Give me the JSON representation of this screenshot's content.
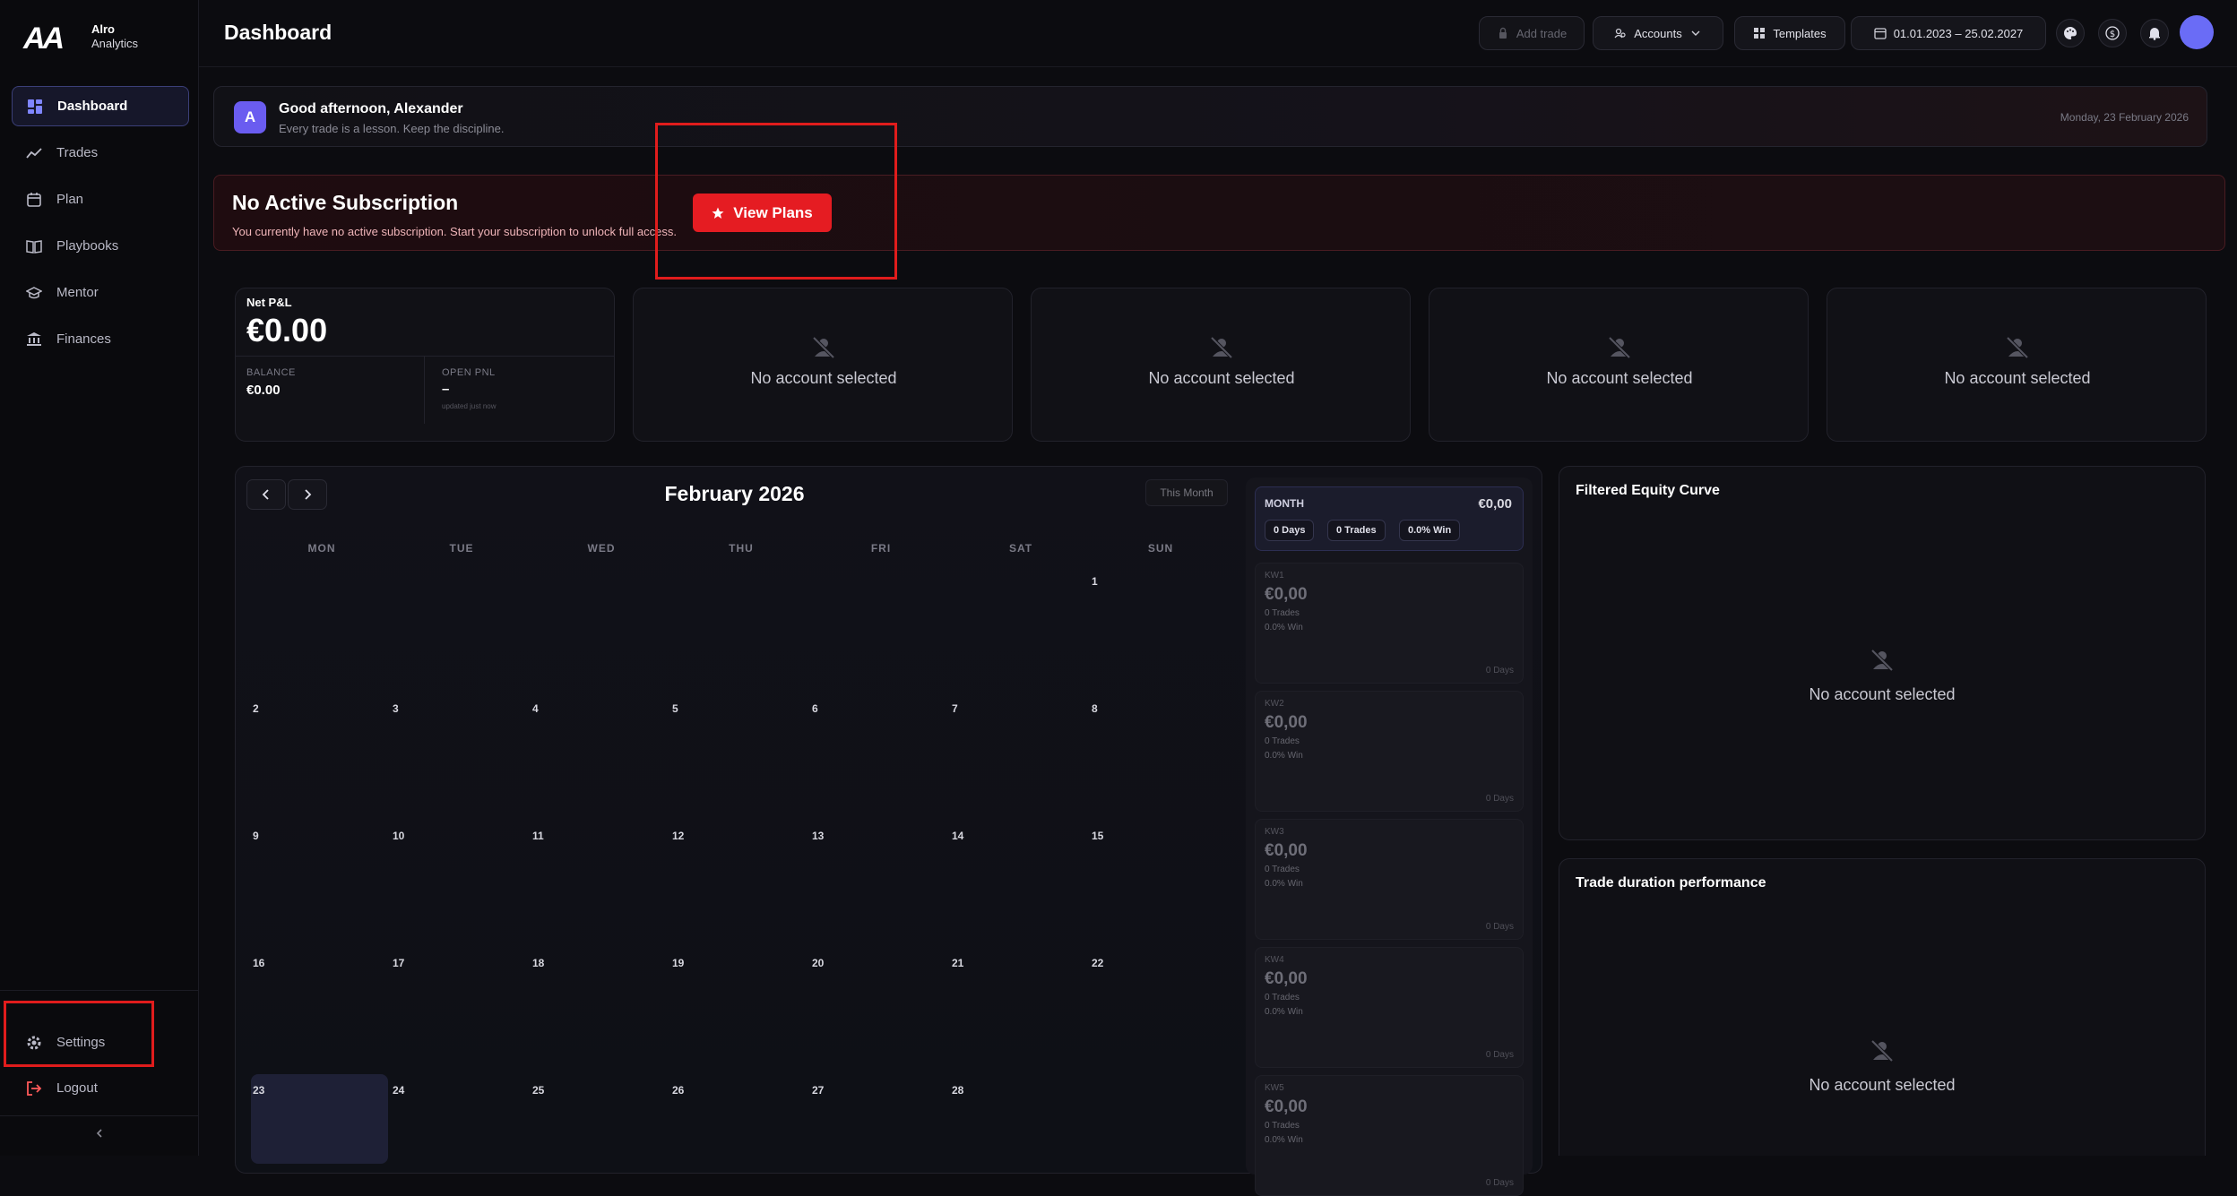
{
  "app": {
    "logo_mark": "AA",
    "logo_name": "Alro",
    "logo_subtitle": "Analytics"
  },
  "sidebar": {
    "items": [
      {
        "label": "Dashboard",
        "icon": "grid-icon",
        "active": true
      },
      {
        "label": "Trades",
        "icon": "trend-line-icon"
      },
      {
        "label": "Plan",
        "icon": "calendar-icon"
      },
      {
        "label": "Playbooks",
        "icon": "book-icon"
      },
      {
        "label": "Mentor",
        "icon": "graduation-cap-icon"
      },
      {
        "label": "Finances",
        "icon": "bank-icon"
      }
    ],
    "settings_label": "Settings",
    "logout_label": "Logout"
  },
  "header": {
    "title": "Dashboard",
    "add_trade_label": "Add trade",
    "accounts_label": "Accounts",
    "templates_label": "Templates",
    "date_range": "01.01.2023 – 25.02.2027"
  },
  "greeting": {
    "avatar_letter": "A",
    "title": "Good afternoon, Alexander",
    "subtitle": "Every trade is a lesson. Keep the discipline.",
    "date": "Monday, 23 February 2026"
  },
  "subscription": {
    "title": "No Active Subscription",
    "text": "You currently have no active subscription. Start your subscription to unlock full access.",
    "button_label": "View Plans"
  },
  "stats": {
    "net_pnl_label": "Net P&L",
    "net_pnl_value": "€0.00",
    "balance_label": "BALANCE",
    "balance_value": "€0.00",
    "open_pnl_label": "OPEN PNL",
    "open_pnl_value": "–",
    "open_pnl_note": "updated just now",
    "empty_text": "No account selected"
  },
  "calendar": {
    "title": "February 2026",
    "this_month_label": "This Month",
    "weekdays": [
      "MON",
      "TUE",
      "WED",
      "THU",
      "FRI",
      "SAT",
      "SUN"
    ],
    "days": [
      "1",
      "2",
      "3",
      "4",
      "5",
      "6",
      "7",
      "8",
      "9",
      "10",
      "11",
      "12",
      "13",
      "14",
      "15",
      "16",
      "17",
      "18",
      "19",
      "20",
      "21",
      "22",
      "23",
      "24",
      "25",
      "26",
      "27",
      "28"
    ],
    "today": "23",
    "month_summary": {
      "label": "MONTH",
      "value": "€0,00",
      "days": "0 Days",
      "trades": "0 Trades",
      "win": "0.0% Win"
    },
    "weeks": [
      {
        "label": "KW1",
        "value": "€0,00",
        "trades": "0 Trades",
        "win": "0.0% Win",
        "days": "0 Days"
      },
      {
        "label": "KW2",
        "value": "€0,00",
        "trades": "0 Trades",
        "win": "0.0% Win",
        "days": "0 Days"
      },
      {
        "label": "KW3",
        "value": "€0,00",
        "trades": "0 Trades",
        "win": "0.0% Win",
        "days": "0 Days"
      },
      {
        "label": "KW4",
        "value": "€0,00",
        "trades": "0 Trades",
        "win": "0.0% Win",
        "days": "0 Days"
      },
      {
        "label": "KW5",
        "value": "€0,00",
        "trades": "0 Trades",
        "win": "0.0% Win",
        "days": "0 Days"
      }
    ]
  },
  "panels": {
    "equity_title": "Filtered Equity Curve",
    "duration_title": "Trade duration performance",
    "empty_text": "No account selected"
  },
  "colors": {
    "accent": "#6a6cf6",
    "danger": "#e51c22",
    "background": "#0c0c10"
  }
}
